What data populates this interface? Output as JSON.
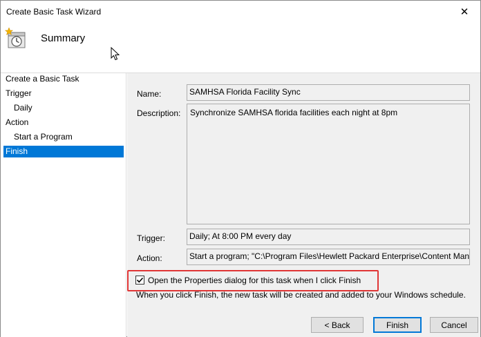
{
  "window": {
    "title": "Create Basic Task Wizard",
    "close_glyph": "✕"
  },
  "header": {
    "title": "Summary",
    "icon": "task-clock-icon"
  },
  "sidebar": {
    "items": [
      {
        "label": "Create a Basic Task",
        "sub": false,
        "active": false
      },
      {
        "label": "Trigger",
        "sub": false,
        "active": false
      },
      {
        "label": "Daily",
        "sub": true,
        "active": false
      },
      {
        "label": "Action",
        "sub": false,
        "active": false
      },
      {
        "label": "Start a Program",
        "sub": true,
        "active": false
      },
      {
        "label": "Finish",
        "sub": false,
        "active": true
      }
    ]
  },
  "summary": {
    "name_label": "Name:",
    "name_value": "SAMHSA Florida Facility Sync",
    "description_label": "Description:",
    "description_value": "Synchronize SAMHSA florida facilities each night at 8pm",
    "trigger_label": "Trigger:",
    "trigger_value": "Daily; At 8:00 PM every day",
    "action_label": "Action:",
    "action_value": "Start a program; \"C:\\Program Files\\Hewlett Packard Enterprise\\Content Mana"
  },
  "options": {
    "open_properties_label": "Open the Properties dialog for this task when I click Finish",
    "open_properties_checked": true
  },
  "info_text": "When you click Finish, the new task will be created and added to your Windows schedule.",
  "buttons": {
    "back": "< Back",
    "finish": "Finish",
    "cancel": "Cancel"
  },
  "colors": {
    "accent": "#0078d7",
    "highlight": "#e03535",
    "panel": "#f0f0f0"
  }
}
